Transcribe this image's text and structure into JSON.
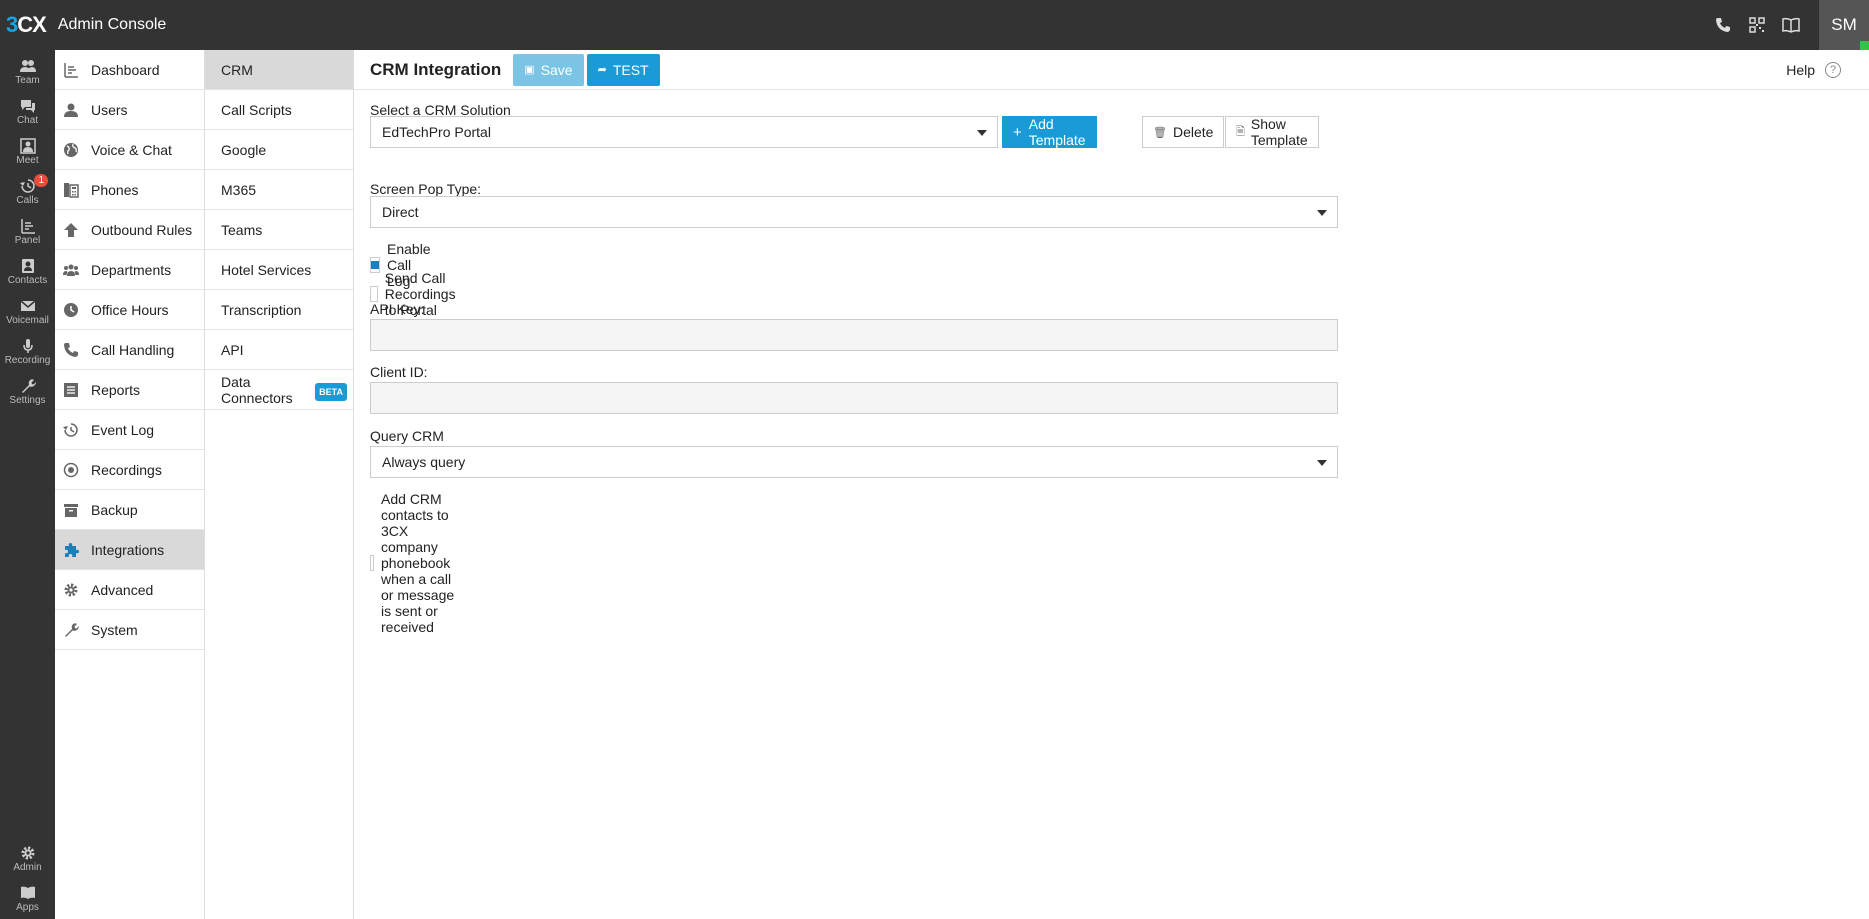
{
  "app": {
    "logo_three": "3",
    "logo_cx": "CX",
    "title": "Admin Console"
  },
  "topbar": {
    "avatar_initials": "SM",
    "icons": [
      "phone-icon",
      "qr-code-icon",
      "book-icon"
    ]
  },
  "rail": {
    "items": [
      {
        "label": "Team",
        "icon": "team-icon"
      },
      {
        "label": "Chat",
        "icon": "chat-icon"
      },
      {
        "label": "Meet",
        "icon": "meet-icon"
      },
      {
        "label": "Calls",
        "icon": "calls-history-icon",
        "badge": "1"
      },
      {
        "label": "Panel",
        "icon": "panel-icon"
      },
      {
        "label": "Contacts",
        "icon": "contacts-icon"
      },
      {
        "label": "Voicemail",
        "icon": "voicemail-icon"
      },
      {
        "label": "Recording",
        "icon": "microphone-icon"
      },
      {
        "label": "Settings",
        "icon": "wrench-icon"
      }
    ],
    "bottom": [
      {
        "label": "Admin",
        "icon": "gear-icon"
      },
      {
        "label": "Apps",
        "icon": "apps-icon"
      }
    ]
  },
  "nav": {
    "items": [
      {
        "label": "Dashboard"
      },
      {
        "label": "Users"
      },
      {
        "label": "Voice & Chat"
      },
      {
        "label": "Phones"
      },
      {
        "label": "Outbound Rules"
      },
      {
        "label": "Departments"
      },
      {
        "label": "Office Hours"
      },
      {
        "label": "Call Handling"
      },
      {
        "label": "Reports"
      },
      {
        "label": "Event Log"
      },
      {
        "label": "Recordings"
      },
      {
        "label": "Backup"
      },
      {
        "label": "Integrations"
      },
      {
        "label": "Advanced"
      },
      {
        "label": "System"
      }
    ]
  },
  "subnav": {
    "items": [
      {
        "label": "CRM"
      },
      {
        "label": "Call Scripts"
      },
      {
        "label": "Google"
      },
      {
        "label": "M365"
      },
      {
        "label": "Teams"
      },
      {
        "label": "Hotel Services"
      },
      {
        "label": "Transcription"
      },
      {
        "label": "API"
      },
      {
        "label": "Data Connectors",
        "badge": "BETA"
      }
    ]
  },
  "page": {
    "title": "CRM Integration",
    "save_label": "Save",
    "test_label": "TEST",
    "help_label": "Help"
  },
  "form": {
    "crm_label": "Select a CRM Solution",
    "crm_value": "EdTechPro Portal",
    "add_template_label": "Add Template",
    "delete_label": "Delete",
    "show_template_label": "Show Template",
    "screen_pop_label": "Screen Pop Type:",
    "screen_pop_value": "Direct",
    "enable_call_log_label": "Enable Call Log",
    "enable_call_log_checked": true,
    "send_recordings_label": "Send Call Recordings to Portal",
    "send_recordings_checked": false,
    "api_key_label": "API Key:",
    "api_key_value": "",
    "client_id_label": "Client ID:",
    "client_id_value": "",
    "query_crm_label": "Query CRM",
    "query_crm_value": "Always query",
    "add_contacts_label": "Add CRM contacts to 3CX company phonebook when a call or message is sent or received",
    "add_contacts_checked": false
  },
  "colors": {
    "accent": "#1a9bd7",
    "topbar": "#333333",
    "active_row": "#d9d9d9",
    "badge": "#e74c3c"
  }
}
